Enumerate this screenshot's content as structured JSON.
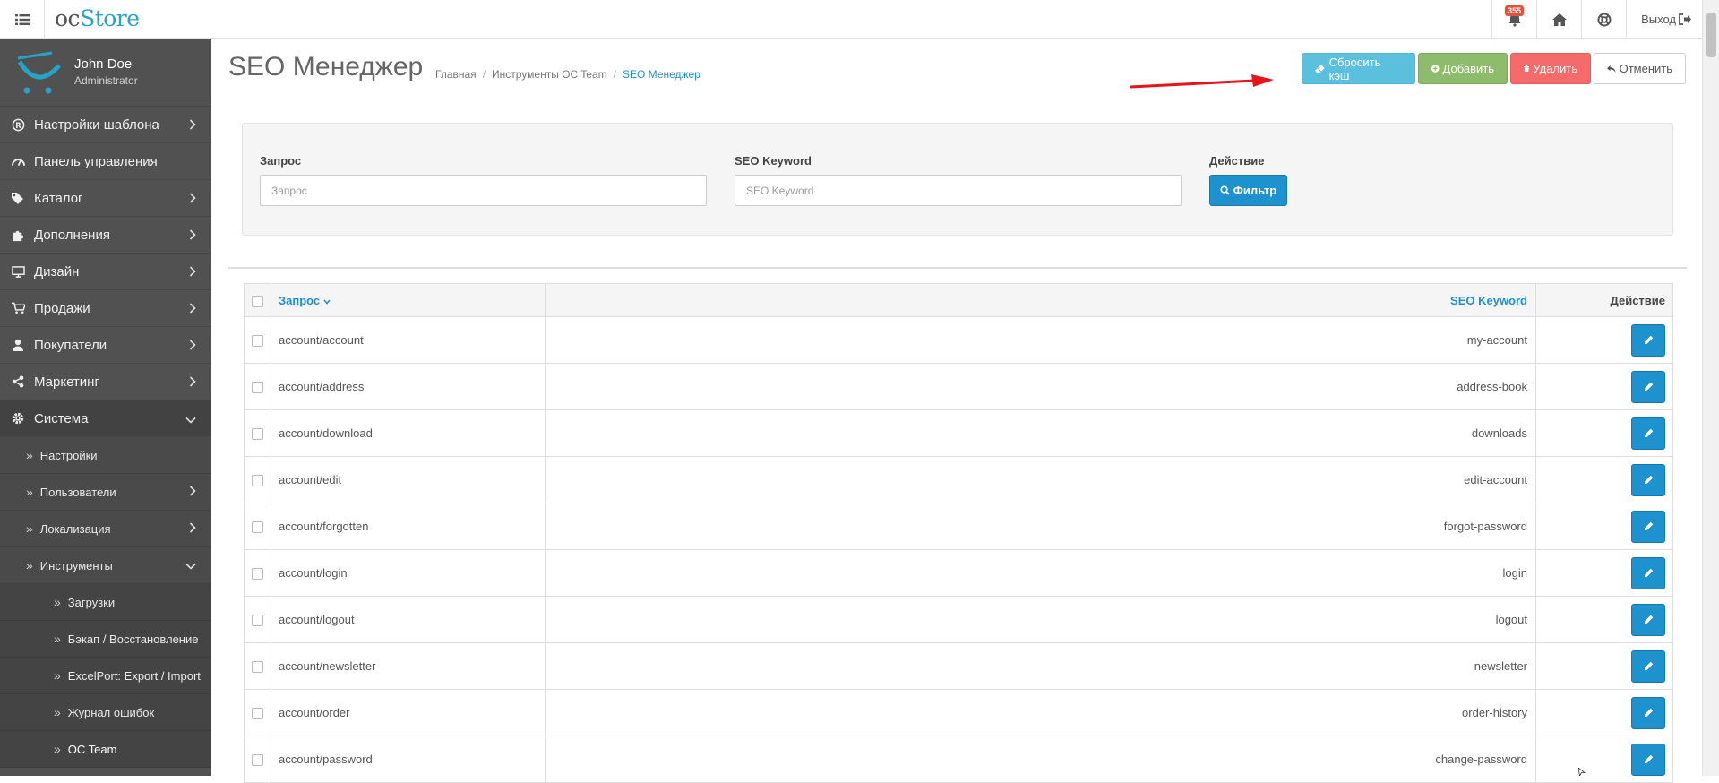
{
  "header": {
    "logo_oc": "oc",
    "logo_store": "Store",
    "notifications_count": "355",
    "logout_label": "Выход"
  },
  "user": {
    "name": "John Doe",
    "role": "Administrator"
  },
  "sidebar": {
    "items": [
      {
        "label": "Настройки шаблона",
        "icon": "registered-icon"
      },
      {
        "label": "Панель управления",
        "icon": "dashboard-icon"
      },
      {
        "label": "Каталог",
        "icon": "tag-icon"
      },
      {
        "label": "Дополнения",
        "icon": "puzzle-icon"
      },
      {
        "label": "Дизайн",
        "icon": "monitor-icon"
      },
      {
        "label": "Продажи",
        "icon": "cart-icon"
      },
      {
        "label": "Покупатели",
        "icon": "user-icon"
      },
      {
        "label": "Маркетинг",
        "icon": "share-icon"
      },
      {
        "label": "Система",
        "icon": "gear-icon"
      }
    ],
    "system_sub": [
      {
        "label": "Настройки"
      },
      {
        "label": "Пользователи"
      },
      {
        "label": "Локализация"
      },
      {
        "label": "Инструменты"
      }
    ],
    "tools_sub": [
      {
        "label": "Загрузки"
      },
      {
        "label": "Бэкап / Восстановление"
      },
      {
        "label": "ExcelPort: Export / Import"
      },
      {
        "label": "Журнал ошибок"
      },
      {
        "label": "OC Team"
      }
    ]
  },
  "page": {
    "title": "SEO Менеджер",
    "breadcrumb": [
      "Главная",
      "Инструменты OC Team",
      "SEO Менеджер"
    ]
  },
  "toolbar": {
    "reset_cache": "Сбросить кэш",
    "add": "Добавить",
    "delete": "Удалить",
    "cancel": "Отменить"
  },
  "filter": {
    "query_label": "Запрос",
    "query_placeholder": "Запрос",
    "keyword_label": "SEO Keyword",
    "keyword_placeholder": "SEO Keyword",
    "action_label": "Действие",
    "filter_button": "Фильтр"
  },
  "table": {
    "headers": {
      "query": "Запрос",
      "keyword": "SEO Keyword",
      "action": "Действие"
    },
    "rows": [
      {
        "query": "account/account",
        "keyword": "my-account"
      },
      {
        "query": "account/address",
        "keyword": "address-book"
      },
      {
        "query": "account/download",
        "keyword": "downloads"
      },
      {
        "query": "account/edit",
        "keyword": "edit-account"
      },
      {
        "query": "account/forgotten",
        "keyword": "forgot-password"
      },
      {
        "query": "account/login",
        "keyword": "login"
      },
      {
        "query": "account/logout",
        "keyword": "logout"
      },
      {
        "query": "account/newsletter",
        "keyword": "newsletter"
      },
      {
        "query": "account/order",
        "keyword": "order-history"
      },
      {
        "query": "account/password",
        "keyword": "change-password"
      }
    ]
  },
  "colors": {
    "primary": "#1e91cf",
    "info": "#5bc0de",
    "success": "#8fbb6c",
    "danger": "#f56b6b",
    "sidebar": "#515151",
    "annotation_arrow": "#e8141d"
  }
}
